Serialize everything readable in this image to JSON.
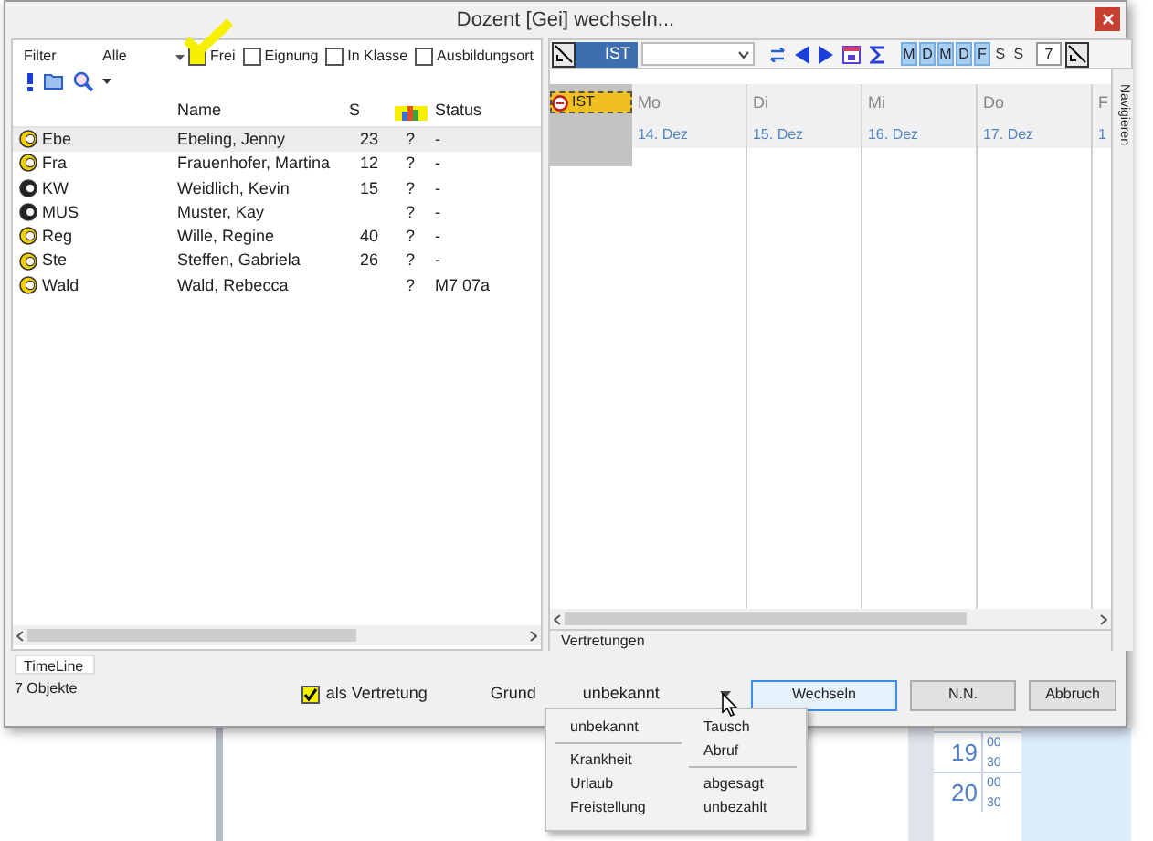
{
  "dialog": {
    "title": "Dozent [Gei] wechseln...",
    "filter": {
      "label": "Filter",
      "value": "Alle",
      "checkboxes": [
        {
          "label": "Frei",
          "checked": false,
          "highlighted": true
        },
        {
          "label": "Eignung",
          "checked": false,
          "highlighted": false
        },
        {
          "label": "In Klasse",
          "checked": false,
          "highlighted": false
        },
        {
          "label": "Ausbildungsort",
          "checked": false,
          "highlighted": false
        }
      ]
    },
    "columns": {
      "name": "Name",
      "s": "S",
      "status": "Status"
    },
    "rows": [
      {
        "code": "Ebe",
        "name": "Ebeling, Jenny",
        "s": "23",
        "q": "?",
        "status": "-",
        "selected": true,
        "kind": "light"
      },
      {
        "code": "Fra",
        "name": "Frauenhofer, Martina",
        "s": "12",
        "q": "?",
        "status": "-",
        "selected": false,
        "kind": "light"
      },
      {
        "code": "KW",
        "name": "Weidlich, Kevin",
        "s": "15",
        "q": "?",
        "status": "-",
        "selected": false,
        "kind": "dark"
      },
      {
        "code": "MUS",
        "name": "Muster, Kay",
        "q": "?",
        "status": "-",
        "selected": false,
        "kind": "dark"
      },
      {
        "code": "Reg",
        "name": "Wille, Regine",
        "s": "40",
        "q": "?",
        "status": "-",
        "selected": false,
        "kind": "light"
      },
      {
        "code": "Ste",
        "name": "Steffen, Gabriela",
        "s": "26",
        "q": "?",
        "status": "-",
        "selected": false,
        "kind": "light"
      },
      {
        "code": "Wald",
        "name": "Wald, Rebecca",
        "q": "?",
        "status": "M7 07a",
        "selected": false,
        "kind": "light"
      }
    ],
    "view": "IST",
    "weekdays": [
      {
        "label": "M",
        "selected": true
      },
      {
        "label": "D",
        "selected": true
      },
      {
        "label": "M",
        "selected": true
      },
      {
        "label": "D",
        "selected": true
      },
      {
        "label": "F",
        "selected": true
      },
      {
        "label": "S",
        "selected": false
      },
      {
        "label": "S",
        "selected": false
      }
    ],
    "week_count": "7",
    "calendar": {
      "badge": "IST",
      "days": [
        {
          "day": "Mo",
          "date": "14. Dez"
        },
        {
          "day": "Di",
          "date": "15. Dez"
        },
        {
          "day": "Mi",
          "date": "16. Dez"
        },
        {
          "day": "Do",
          "date": "17. Dez"
        },
        {
          "day": "F",
          "date": "1"
        }
      ]
    },
    "side_tab": "Navigieren",
    "bottom_tab": "Vertretungen",
    "footer": {
      "tab": "TimeLine",
      "count": "7 Objekte",
      "substitute": {
        "label": "als Vertretung",
        "checked": true
      },
      "reason_label": "Grund",
      "reason_value": "unbekannt",
      "buttons": [
        {
          "label": "Wechseln",
          "default": true
        },
        {
          "label": "N.N.",
          "default": false
        },
        {
          "label": "Abbruch",
          "default": false
        }
      ]
    }
  },
  "menu": {
    "columns": [
      [
        {
          "kind": "item",
          "label": "unbekannt"
        },
        {
          "kind": "separator"
        },
        {
          "kind": "item",
          "label": "Krankheit"
        },
        {
          "kind": "item",
          "label": "Urlaub"
        },
        {
          "kind": "item",
          "label": "Freistellung"
        }
      ],
      [
        {
          "kind": "item",
          "label": "Tausch"
        },
        {
          "kind": "item",
          "label": "Abruf"
        },
        {
          "kind": "separator"
        },
        {
          "kind": "item",
          "label": "abgesagt"
        },
        {
          "kind": "item",
          "label": "unbezahlt"
        }
      ]
    ]
  },
  "background": {
    "times": [
      {
        "hour": "19",
        "minutes": [
          "00",
          "30"
        ]
      },
      {
        "hour": "20",
        "minutes": [
          "00",
          "30"
        ]
      }
    ]
  }
}
